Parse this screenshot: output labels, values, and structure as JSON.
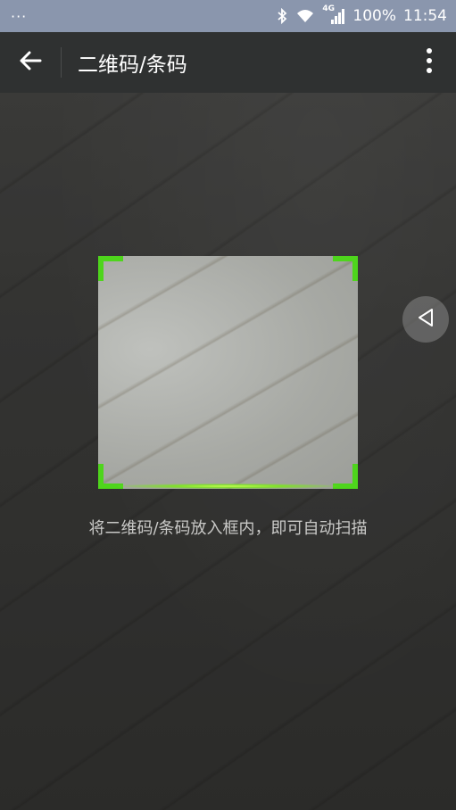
{
  "status_bar": {
    "left": "···",
    "network": "4G",
    "battery": "100%",
    "time": "11:54",
    "icons": [
      "bluetooth-icon",
      "wifi-icon",
      "signal-icon"
    ]
  },
  "app_bar": {
    "title": "二维码/条码",
    "back_icon": "arrow-left-icon",
    "menu_icon": "more-vert-icon"
  },
  "scanner": {
    "hint": "将二维码/条码放入框内，即可自动扫描",
    "frame_color": "#4ed51c"
  },
  "side_handle": {
    "icon": "triangle-left-icon"
  }
}
